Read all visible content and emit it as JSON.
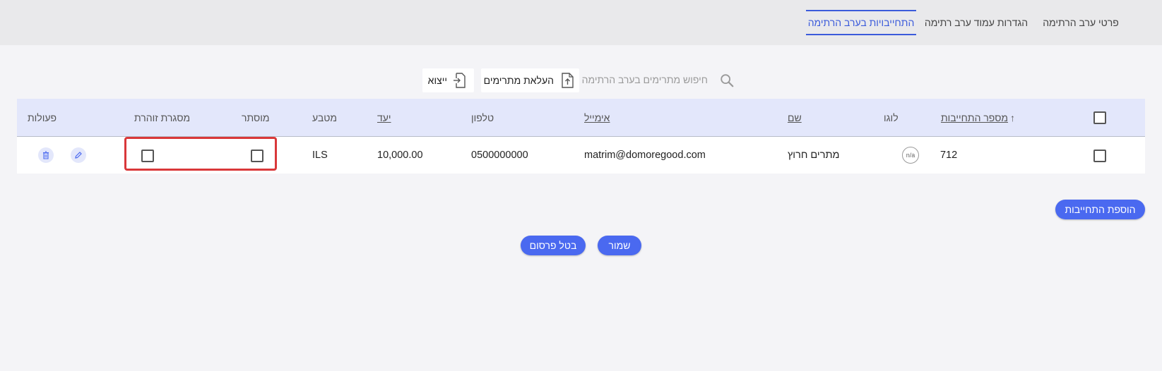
{
  "tabs": [
    {
      "label": "פרטי ערב הרתימה",
      "active": false
    },
    {
      "label": "הגדרות עמוד ערב רתימה",
      "active": false
    },
    {
      "label": "התחייבויות בערב הרתימה",
      "active": true
    }
  ],
  "toolbar": {
    "search_placeholder": "חיפוש מתרימים בערב הרתימה",
    "upload_label": "העלאת מתרימים",
    "export_label": "ייצוא"
  },
  "table": {
    "headers": {
      "commitment_number": "מספר התחייבות",
      "logo": "לוגו",
      "name": "שם",
      "email": "אימייל",
      "phone": "טלפון",
      "target": "יעד",
      "currency": "מטבע",
      "hidden": "מוסתר",
      "glow_frame": "מסגרת זוהרת",
      "actions": "פעולות"
    },
    "sort_indicator": "↑",
    "rows": [
      {
        "commitment_number": "712",
        "logo": "n/a",
        "name": "מתרים חרוץ",
        "email": "matrim@domoregood.com",
        "phone": "0500000000",
        "target": "10,000.00",
        "currency": "ILS",
        "hidden": false,
        "glow_frame": false
      }
    ]
  },
  "buttons": {
    "add_commitment": "הוספת התחייבות",
    "save": "שמור",
    "cancel_publish": "בטל פרסום"
  },
  "colors": {
    "accent": "#4a69f0",
    "header_bg": "#e3e7fb",
    "highlight": "#d9383a"
  }
}
